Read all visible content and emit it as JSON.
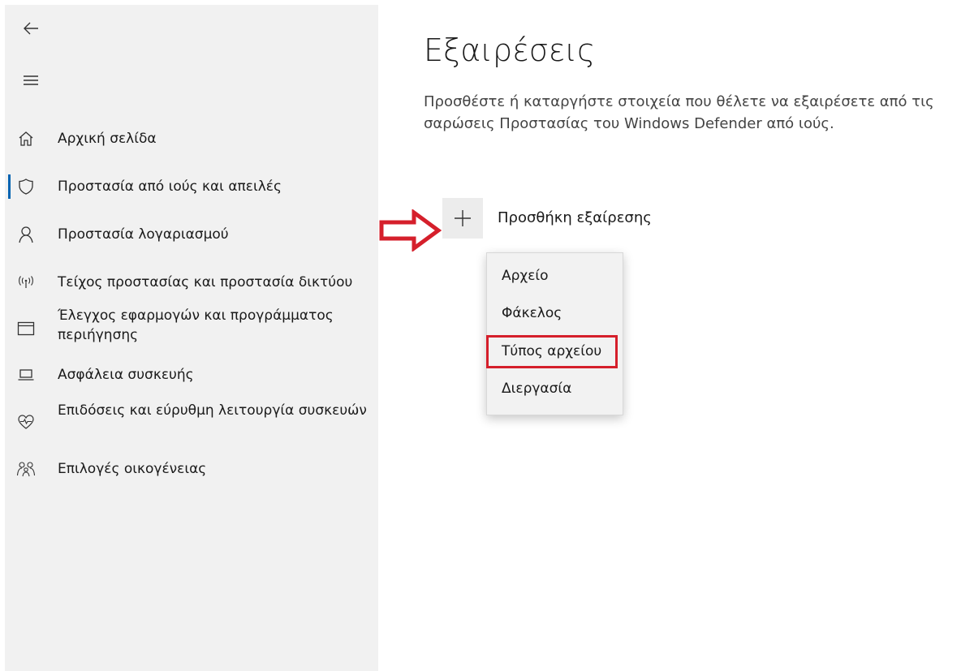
{
  "sidebar": {
    "back_icon": "back-arrow-icon",
    "menu_icon": "hamburger-menu-icon",
    "items": [
      {
        "label": "Αρχική σελίδα",
        "icon": "home-icon"
      },
      {
        "label": "Προστασία από ιούς και απειλές",
        "icon": "shield-icon",
        "active": true
      },
      {
        "label": "Προστασία λογαριασμού",
        "icon": "person-icon"
      },
      {
        "label": "Τείχος προστασίας και προστασία δικτύου",
        "icon": "wifi-antenna-icon"
      },
      {
        "label": "Έλεγχος εφαρμογών και προγράμματος περιήγησης",
        "icon": "browser-window-icon"
      },
      {
        "label": "Ασφάλεια συσκευής",
        "icon": "laptop-icon"
      },
      {
        "label": "Επιδόσεις και εύρυθμη λειτουργία συσκευών",
        "icon": "heart-icon"
      },
      {
        "label": "Επιλογές οικογένειας",
        "icon": "family-icon"
      }
    ]
  },
  "main": {
    "title": "Εξαιρέσεις",
    "description": "Προσθέστε ή καταργήστε στοιχεία που θέλετε να εξαιρέσετε από τις σαρώσεις Προστασίας του Windows Defender από ιούς.",
    "add_exclusion_label": "Προσθήκη εξαίρεσης",
    "add_icon": "plus-icon"
  },
  "dropdown": {
    "items": [
      "Αρχείο",
      "Φάκελος",
      "Τύπος αρχείου",
      "Διεργασία"
    ],
    "highlighted": "Τύπος αρχείου"
  },
  "colors": {
    "accent": "#0063b1",
    "annotation_red": "#d51f2b",
    "sidebar_bg": "#f1f1f1"
  }
}
